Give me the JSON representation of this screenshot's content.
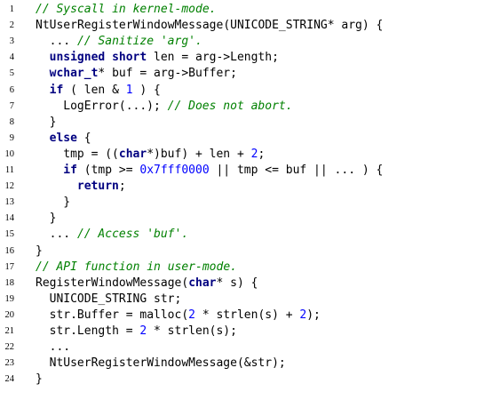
{
  "listing": {
    "lines": [
      {
        "no": "1",
        "indent": 0,
        "tokens": [
          {
            "t": "cm",
            "v": "// Syscall in kernel-mode."
          }
        ]
      },
      {
        "no": "2",
        "indent": 0,
        "tokens": [
          {
            "t": "p",
            "v": "NtUserRegisterWindowMessage(UNICODE_STRING* arg) {"
          }
        ]
      },
      {
        "no": "3",
        "indent": 2,
        "tokens": [
          {
            "t": "p",
            "v": "... "
          },
          {
            "t": "cm",
            "v": "// Sanitize 'arg'."
          }
        ]
      },
      {
        "no": "4",
        "indent": 2,
        "tokens": [
          {
            "t": "kw",
            "v": "unsigned short"
          },
          {
            "t": "p",
            "v": " len = arg->Length;"
          }
        ]
      },
      {
        "no": "5",
        "indent": 2,
        "tokens": [
          {
            "t": "kw",
            "v": "wchar_t"
          },
          {
            "t": "p",
            "v": "* buf = arg->Buffer;"
          }
        ]
      },
      {
        "no": "6",
        "indent": 2,
        "tokens": [
          {
            "t": "kw",
            "v": "if"
          },
          {
            "t": "p",
            "v": " ( len & "
          },
          {
            "t": "num",
            "v": "1"
          },
          {
            "t": "p",
            "v": " ) {"
          }
        ]
      },
      {
        "no": "7",
        "indent": 4,
        "tokens": [
          {
            "t": "p",
            "v": "LogError(...); "
          },
          {
            "t": "cm",
            "v": "// Does not abort."
          }
        ]
      },
      {
        "no": "8",
        "indent": 2,
        "tokens": [
          {
            "t": "p",
            "v": "}"
          }
        ]
      },
      {
        "no": "9",
        "indent": 2,
        "tokens": [
          {
            "t": "kw",
            "v": "else"
          },
          {
            "t": "p",
            "v": " {"
          }
        ]
      },
      {
        "no": "10",
        "indent": 4,
        "tokens": [
          {
            "t": "p",
            "v": "tmp = (("
          },
          {
            "t": "kw",
            "v": "char"
          },
          {
            "t": "p",
            "v": "*)buf) + len + "
          },
          {
            "t": "num",
            "v": "2"
          },
          {
            "t": "p",
            "v": ";"
          }
        ]
      },
      {
        "no": "11",
        "indent": 4,
        "tokens": [
          {
            "t": "kw",
            "v": "if"
          },
          {
            "t": "p",
            "v": " (tmp >= "
          },
          {
            "t": "num",
            "v": "0x7fff0000"
          },
          {
            "t": "p",
            "v": " || tmp <= buf || ... ) {"
          }
        ]
      },
      {
        "no": "12",
        "indent": 6,
        "tokens": [
          {
            "t": "kw",
            "v": "return"
          },
          {
            "t": "p",
            "v": ";"
          }
        ]
      },
      {
        "no": "13",
        "indent": 4,
        "tokens": [
          {
            "t": "p",
            "v": "}"
          }
        ]
      },
      {
        "no": "14",
        "indent": 2,
        "tokens": [
          {
            "t": "p",
            "v": "}"
          }
        ]
      },
      {
        "no": "15",
        "indent": 2,
        "tokens": [
          {
            "t": "p",
            "v": "... "
          },
          {
            "t": "cm",
            "v": "// Access 'buf'."
          }
        ]
      },
      {
        "no": "16",
        "indent": 0,
        "tokens": [
          {
            "t": "p",
            "v": "}"
          }
        ]
      },
      {
        "no": "17",
        "indent": 0,
        "tokens": [
          {
            "t": "cm",
            "v": "// API function in user-mode."
          }
        ]
      },
      {
        "no": "18",
        "indent": 0,
        "tokens": [
          {
            "t": "p",
            "v": "RegisterWindowMessage("
          },
          {
            "t": "kw",
            "v": "char"
          },
          {
            "t": "p",
            "v": "* s) {"
          }
        ]
      },
      {
        "no": "19",
        "indent": 2,
        "tokens": [
          {
            "t": "p",
            "v": "UNICODE_STRING str;"
          }
        ]
      },
      {
        "no": "20",
        "indent": 2,
        "tokens": [
          {
            "t": "p",
            "v": "str.Buffer = malloc("
          },
          {
            "t": "num",
            "v": "2"
          },
          {
            "t": "p",
            "v": " * strlen(s) + "
          },
          {
            "t": "num",
            "v": "2"
          },
          {
            "t": "p",
            "v": ");"
          }
        ]
      },
      {
        "no": "21",
        "indent": 2,
        "tokens": [
          {
            "t": "p",
            "v": "str.Length = "
          },
          {
            "t": "num",
            "v": "2"
          },
          {
            "t": "p",
            "v": " * strlen(s);"
          }
        ]
      },
      {
        "no": "22",
        "indent": 2,
        "tokens": [
          {
            "t": "p",
            "v": "..."
          }
        ]
      },
      {
        "no": "23",
        "indent": 2,
        "tokens": [
          {
            "t": "p",
            "v": "NtUserRegisterWindowMessage(&str);"
          }
        ]
      },
      {
        "no": "24",
        "indent": 0,
        "tokens": [
          {
            "t": "p",
            "v": "}"
          }
        ]
      }
    ]
  }
}
